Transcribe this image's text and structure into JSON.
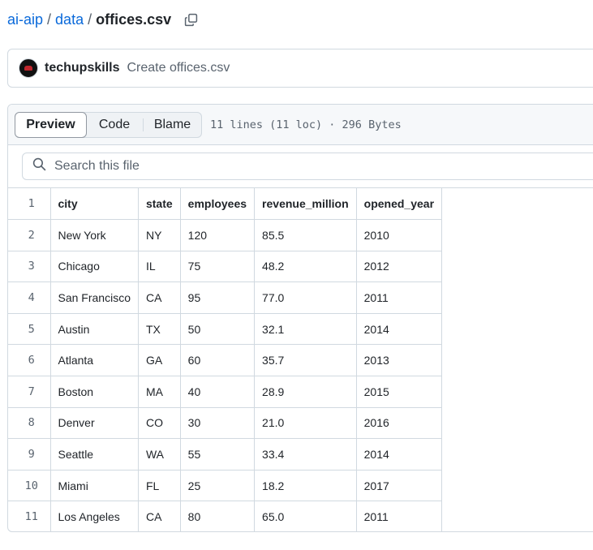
{
  "breadcrumb": {
    "repo": "ai-aip",
    "folder": "data",
    "file": "offices.csv",
    "separator": "/"
  },
  "commit": {
    "author": "techupskills",
    "message": "Create offices.csv"
  },
  "toolbar": {
    "preview": "Preview",
    "code": "Code",
    "blame": "Blame",
    "meta": "11 lines (11 loc) · 296 Bytes"
  },
  "search": {
    "placeholder": "Search this file"
  },
  "table": {
    "line_numbers": [
      "1",
      "2",
      "3",
      "4",
      "5",
      "6",
      "7",
      "8",
      "9",
      "10",
      "11"
    ],
    "header": [
      "city",
      "state",
      "employees",
      "revenue_million",
      "opened_year"
    ],
    "rows": [
      [
        "New York",
        "NY",
        "120",
        "85.5",
        "2010"
      ],
      [
        "Chicago",
        "IL",
        "75",
        "48.2",
        "2012"
      ],
      [
        "San Francisco",
        "CA",
        "95",
        "77.0",
        "2011"
      ],
      [
        "Austin",
        "TX",
        "50",
        "32.1",
        "2014"
      ],
      [
        "Atlanta",
        "GA",
        "60",
        "35.7",
        "2013"
      ],
      [
        "Boston",
        "MA",
        "40",
        "28.9",
        "2015"
      ],
      [
        "Denver",
        "CO",
        "30",
        "21.0",
        "2016"
      ],
      [
        "Seattle",
        "WA",
        "55",
        "33.4",
        "2014"
      ],
      [
        "Miami",
        "FL",
        "25",
        "18.2",
        "2017"
      ],
      [
        "Los Angeles",
        "CA",
        "80",
        "65.0",
        "2011"
      ]
    ]
  },
  "colors": {
    "link": "#0969da",
    "border": "#d1d9e0",
    "muted": "#59636e",
    "header_bg": "#f6f8fa",
    "avatar_accent": "#c0262d"
  },
  "icons": {
    "copy": "copy-icon",
    "search": "search-icon",
    "avatar": "user-avatar"
  }
}
